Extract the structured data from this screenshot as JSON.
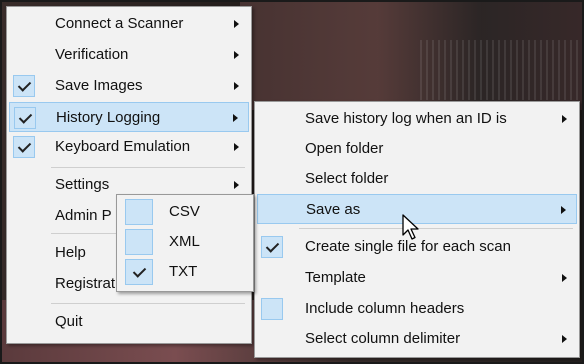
{
  "main_menu": {
    "items": [
      {
        "label": "Connect a Scanner",
        "checked": false,
        "submenu": true
      },
      {
        "label": "Verification",
        "checked": false,
        "submenu": true
      },
      {
        "label": "Save Images",
        "checked": true,
        "submenu": true
      },
      {
        "label": "History Logging",
        "checked": true,
        "submenu": true,
        "highlighted": true
      },
      {
        "label": "Keyboard Emulation",
        "checked": true,
        "submenu": true
      },
      {
        "label": "Settings",
        "checked": false,
        "submenu": true
      },
      {
        "label": "Admin P",
        "checked": false,
        "submenu": false
      },
      {
        "label": "Help",
        "checked": false,
        "submenu": false
      },
      {
        "label": "Registrat",
        "checked": false,
        "submenu": false
      },
      {
        "label": "Quit",
        "checked": false,
        "submenu": false
      }
    ]
  },
  "history_submenu": {
    "items": [
      {
        "label": "Save history log when an ID is",
        "checked": false,
        "submenu": true
      },
      {
        "label": "Open folder",
        "checked": false,
        "submenu": false
      },
      {
        "label": "Select folder",
        "checked": false,
        "submenu": false
      },
      {
        "label": "Save as",
        "checked": false,
        "submenu": true,
        "highlighted": true
      },
      {
        "label": "Create single file for each scan",
        "checked": true,
        "submenu": false
      },
      {
        "label": "Template",
        "checked": false,
        "submenu": true
      },
      {
        "label": "Include column headers",
        "checked": false,
        "box": true,
        "submenu": false
      },
      {
        "label": "Select column delimiter",
        "checked": false,
        "submenu": true
      }
    ]
  },
  "save_as_submenu": {
    "items": [
      {
        "label": "CSV",
        "checked": false
      },
      {
        "label": "XML",
        "checked": false
      },
      {
        "label": "TXT",
        "checked": true
      }
    ]
  },
  "colors": {
    "highlight": "#cce4f7",
    "highlight_border": "#99c9ef",
    "menu_bg": "#f2f2f2"
  },
  "icons": {
    "cursor": "mouse-pointer-icon",
    "checkmark": "checkmark-icon",
    "arrow": "chevron-right-icon"
  }
}
